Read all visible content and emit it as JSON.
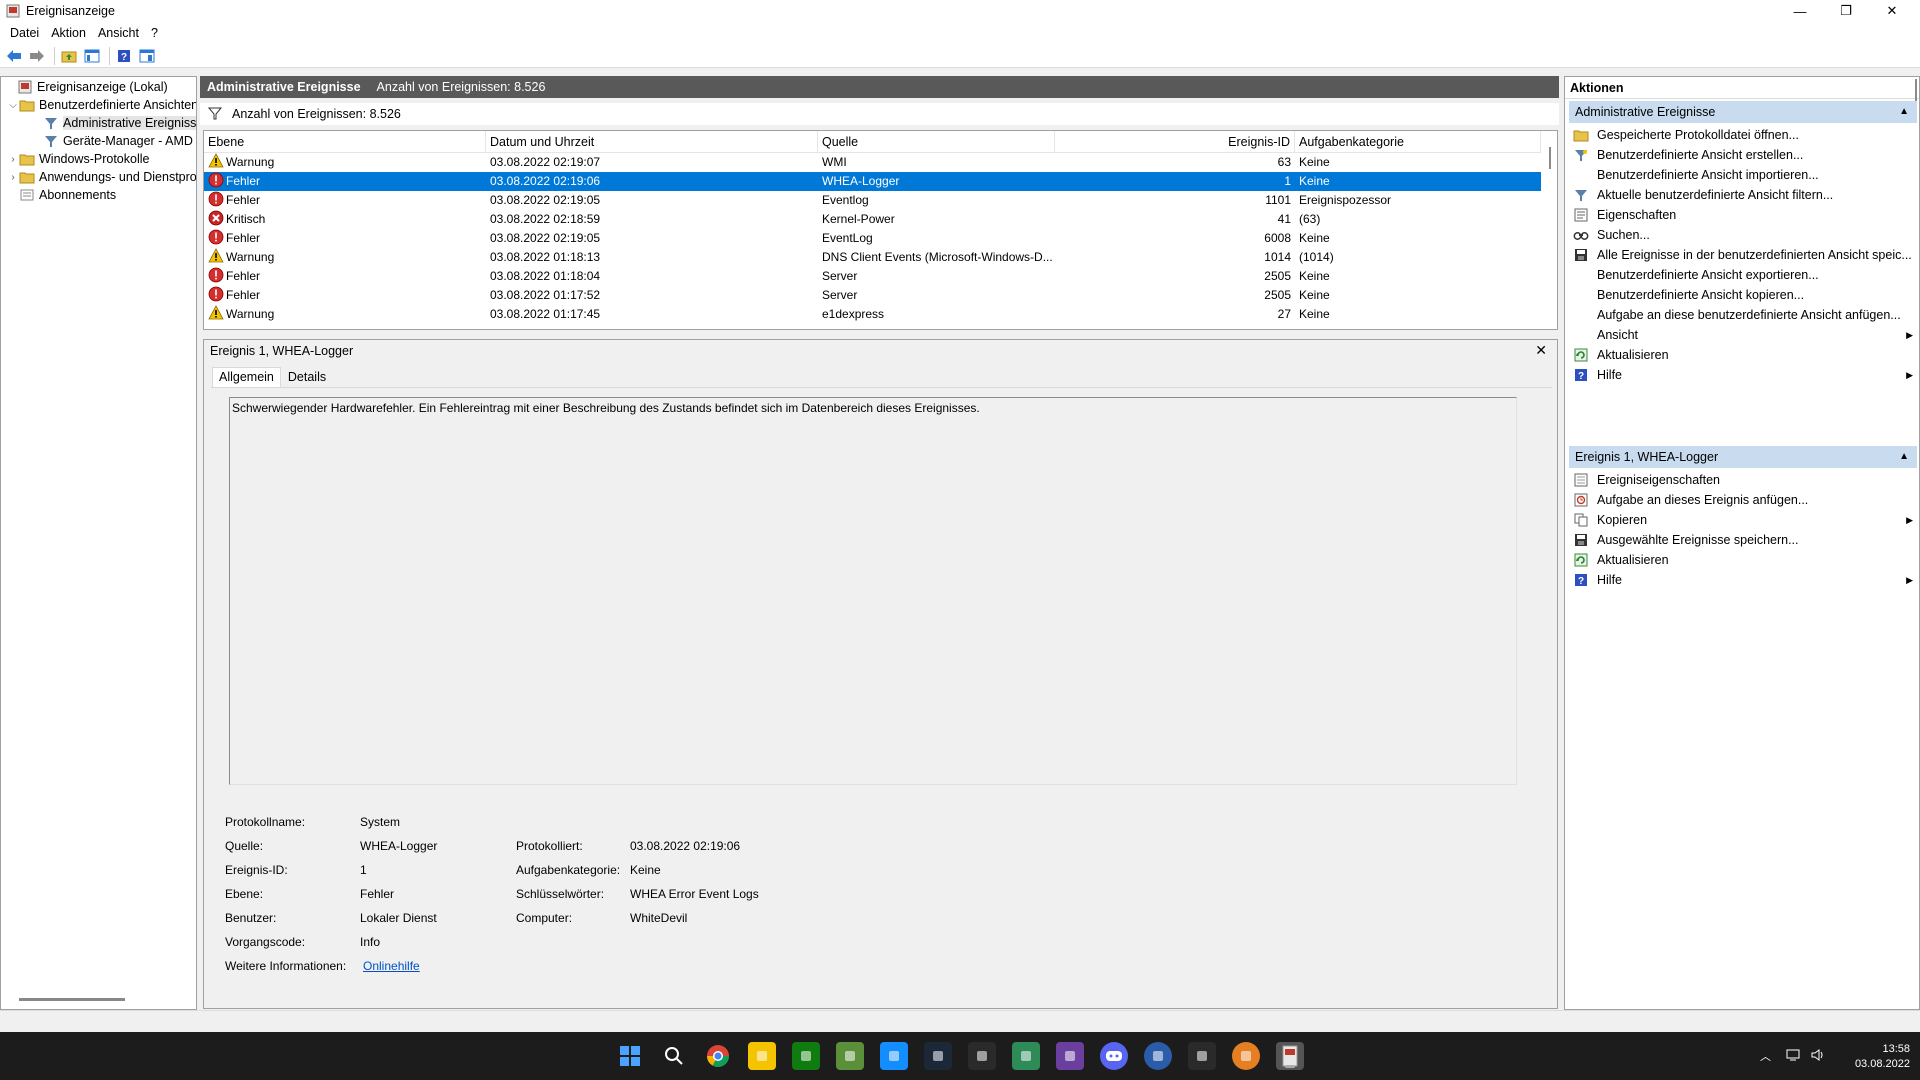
{
  "window": {
    "title": "Ereignisanzeige",
    "controls": {
      "minimize": "—",
      "maximize": "❐",
      "close": "✕"
    }
  },
  "menu": [
    "Datei",
    "Aktion",
    "Ansicht",
    "?"
  ],
  "toolbar": [
    "back-icon",
    "forward-icon",
    "folder-up-icon",
    "console-tree-icon",
    "help-icon",
    "properties-icon"
  ],
  "tree": [
    {
      "label": "Ereignisanzeige (Lokal)",
      "icon": "event-viewer-icon"
    },
    {
      "label": "Benutzerdefinierte Ansichten",
      "icon": "folder-icon"
    },
    {
      "label": "Administrative Ereignisse",
      "icon": "filter-icon"
    },
    {
      "label": "Geräte-Manager - AMD F",
      "icon": "filter-icon"
    },
    {
      "label": "Windows-Protokolle",
      "icon": "folder-icon"
    },
    {
      "label": "Anwendungs- und Dienstpro",
      "icon": "folder-icon"
    },
    {
      "label": "Abonnements",
      "icon": "subscriptions-icon"
    }
  ],
  "header": {
    "title": "Administrative Ereignisse",
    "count": "Anzahl von Ereignissen: 8.526"
  },
  "filter": {
    "count": "Anzahl von Ereignissen: 8.526"
  },
  "grid": {
    "columns": [
      "Ebene",
      "Datum und Uhrzeit",
      "Quelle",
      "Ereignis-ID",
      "Aufgabenkategorie"
    ],
    "rows": [
      {
        "level": "Warnung",
        "icon": "warning",
        "date": "03.08.2022 02:19:07",
        "source": "WMI",
        "id": "63",
        "category": "Keine"
      },
      {
        "level": "Fehler",
        "icon": "error",
        "date": "03.08.2022 02:19:06",
        "source": "WHEA-Logger",
        "id": "1",
        "category": "Keine"
      },
      {
        "level": "Fehler",
        "icon": "error",
        "date": "03.08.2022 02:19:05",
        "source": "Eventlog",
        "id": "1101",
        "category": "Ereignispozessor"
      },
      {
        "level": "Kritisch",
        "icon": "critical",
        "date": "03.08.2022 02:18:59",
        "source": "Kernel-Power",
        "id": "41",
        "category": "(63)"
      },
      {
        "level": "Fehler",
        "icon": "error",
        "date": "03.08.2022 02:19:05",
        "source": "EventLog",
        "id": "6008",
        "category": "Keine"
      },
      {
        "level": "Warnung",
        "icon": "warning",
        "date": "03.08.2022 01:18:13",
        "source": "DNS Client Events (Microsoft-Windows-D...",
        "id": "1014",
        "category": "(1014)"
      },
      {
        "level": "Fehler",
        "icon": "error",
        "date": "03.08.2022 01:18:04",
        "source": "Server",
        "id": "2505",
        "category": "Keine"
      },
      {
        "level": "Fehler",
        "icon": "error",
        "date": "03.08.2022 01:17:52",
        "source": "Server",
        "id": "2505",
        "category": "Keine"
      },
      {
        "level": "Warnung",
        "icon": "warning",
        "date": "03.08.2022 01:17:45",
        "source": "e1dexpress",
        "id": "27",
        "category": "Keine"
      }
    ]
  },
  "detail": {
    "title": "Ereignis 1, WHEA-Logger",
    "close": "✕",
    "tabs": [
      "Allgemein",
      "Details"
    ],
    "message": "Schwerwiegender Hardwarefehler. Ein Fehlereintrag mit einer Beschreibung des Zustands befindet sich im Datenbereich dieses Ereignisses.",
    "labels": {
      "log_name": "Protokollname:",
      "source": "Quelle:",
      "event_id": "Ereignis-ID:",
      "level": "Ebene:",
      "user": "Benutzer:",
      "opcode": "Vorgangscode:",
      "more_info": "Weitere Informationen:",
      "logged": "Protokolliert:",
      "task_category": "Aufgabenkategorie:",
      "keywords": "Schlüsselwörter:",
      "computer": "Computer:"
    },
    "values": {
      "log_name": "System",
      "source": "WHEA-Logger",
      "event_id": "1",
      "level": "Fehler",
      "user": "Lokaler Dienst",
      "opcode": "Info",
      "more_info": "Onlinehilfe",
      "logged": "03.08.2022 02:19:06",
      "task_category": "Keine",
      "keywords": "WHEA Error Event Logs",
      "computer": "WhiteDevil"
    }
  },
  "actions": {
    "title": "Aktionen",
    "section1": {
      "title": "Administrative Ereignisse",
      "items": [
        {
          "label": "Gespeicherte Protokolldatei öffnen...",
          "icon": "open-log-icon"
        },
        {
          "label": "Benutzerdefinierte Ansicht erstellen...",
          "icon": "create-view-icon"
        },
        {
          "label": "Benutzerdefinierte Ansicht importieren...",
          "icon": ""
        },
        {
          "label": "Aktuelle benutzerdefinierte Ansicht filtern...",
          "icon": "filter-icon"
        },
        {
          "label": "Eigenschaften",
          "icon": "properties-icon"
        },
        {
          "label": "Suchen...",
          "icon": "find-icon"
        },
        {
          "label": "Alle Ereignisse in der benutzerdefinierten Ansicht speic...",
          "icon": "save-icon"
        },
        {
          "label": "Benutzerdefinierte Ansicht exportieren...",
          "icon": ""
        },
        {
          "label": "Benutzerdefinierte Ansicht kopieren...",
          "icon": ""
        },
        {
          "label": "Aufgabe an diese benutzerdefinierte Ansicht anfügen...",
          "icon": ""
        },
        {
          "label": "Ansicht",
          "icon": "",
          "submenu": true
        },
        {
          "label": "Aktualisieren",
          "icon": "refresh-icon"
        },
        {
          "label": "Hilfe",
          "icon": "help-icon",
          "submenu": true
        }
      ]
    },
    "section2": {
      "title": "Ereignis 1, WHEA-Logger",
      "items": [
        {
          "label": "Ereigniseigenschaften",
          "icon": "event-properties-icon"
        },
        {
          "label": "Aufgabe an dieses Ereignis anfügen...",
          "icon": "attach-task-icon"
        },
        {
          "label": "Kopieren",
          "icon": "copy-icon",
          "submenu": true
        },
        {
          "label": "Ausgewählte Ereignisse speichern...",
          "icon": "save-icon"
        },
        {
          "label": "Aktualisieren",
          "icon": "refresh-icon"
        },
        {
          "label": "Hilfe",
          "icon": "help-icon",
          "submenu": true
        }
      ]
    }
  },
  "taskbar": {
    "apps": [
      "start-icon",
      "search-icon",
      "chrome-icon",
      "explorer-icon",
      "xbox-icon",
      "minecraft-icon",
      "battlenet-icon",
      "steam-icon",
      "app-grid-icon",
      "xbox-game-icon",
      "purple-app-icon",
      "discord-icon",
      "blue-orb-icon",
      "figure-icon",
      "orange-app-icon",
      "event-viewer-icon"
    ],
    "clock": {
      "time": "13:58",
      "date": "03.08.2022"
    }
  }
}
